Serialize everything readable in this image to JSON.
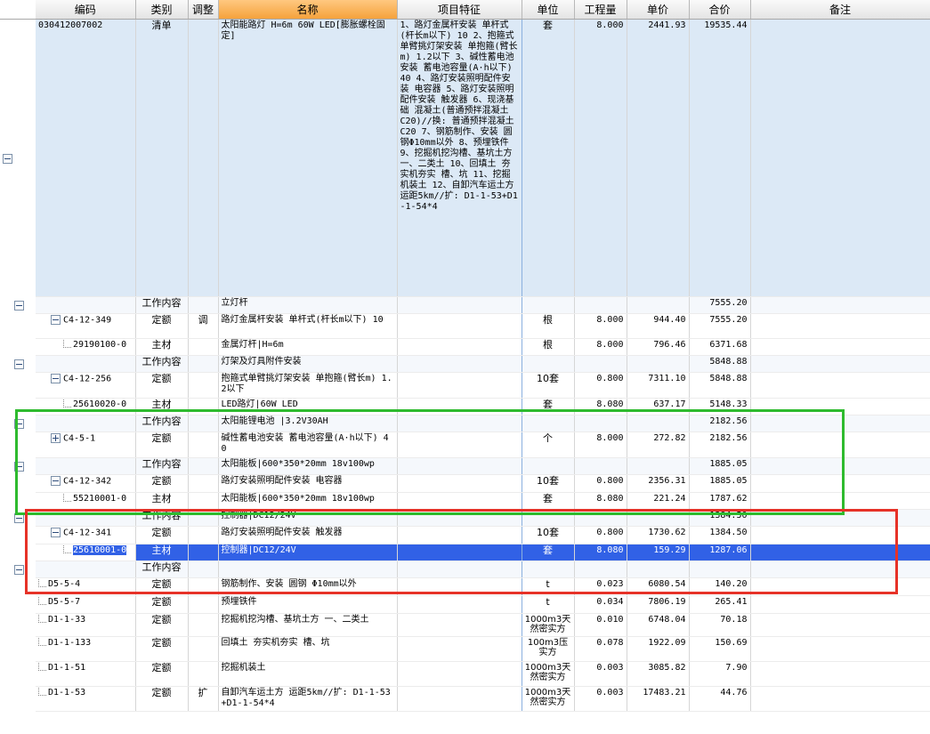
{
  "columns": {
    "code": "编码",
    "type": "类别",
    "adjust": "调整",
    "name": "名称",
    "spec": "项目特征",
    "unit": "单位",
    "qty": "工程量",
    "price": "单价",
    "total": "合价",
    "note": "备注"
  },
  "qingdan": {
    "code": "030412007002",
    "type": "清单",
    "name": "太阳能路灯 H=6m 60W LED[膨胀螺栓固定]",
    "spec": "1、路灯金属杆安装 单杆式(杆长m以下) 10 2、抱箍式单臂挑灯架安装 单抱箍(臂长m) 1.2以下 3、碱性蓄电池安装 蓄电池容量(A·h以下) 40 4、路灯安装照明配件安装 电容器 5、路灯安装照明配件安装 触发器 6、现浇基础 混凝土(普通预拌混凝土 C20)//换: 普通预拌混凝土 C20 7、钢筋制作、安装 圆钢Φ10mm以外 8、预埋铁件 9、挖掘机挖沟槽、基坑土方 一、二类土 10、回填土 夯实机夯实 槽、坑 11、挖掘机装土 12、自卸汽车运土方 运距5km//扩: D1-1-53+D1-1-54*4",
    "unit": "套",
    "qty": "8.000",
    "price": "2441.93",
    "total": "19535.44"
  },
  "rows": [
    {
      "kind": "wc",
      "level": 0,
      "btn": "minus",
      "code": "",
      "type": "工作内容",
      "adjust": "",
      "name": "立灯杆",
      "unit": "",
      "qty": "",
      "price": "",
      "total": "7555.20"
    },
    {
      "kind": "de",
      "level": 1,
      "btn": "minus",
      "code": "C4-12-349",
      "type": "定额",
      "adjust": "调",
      "name": "路灯金属杆安装 单杆式(杆长m以下) 10",
      "unit": "根",
      "qty": "8.000",
      "price": "944.40",
      "total": "7555.20"
    },
    {
      "kind": "zc",
      "level": 2,
      "btn": "line",
      "code": "29190100-0",
      "type": "主材",
      "adjust": "",
      "name": "金属灯杆|H=6m",
      "unit": "根",
      "qty": "8.000",
      "price": "796.46",
      "total": "6371.68"
    },
    {
      "kind": "wc",
      "level": 0,
      "btn": "minus",
      "code": "",
      "type": "工作内容",
      "adjust": "",
      "name": "灯架及灯具附件安装",
      "unit": "",
      "qty": "",
      "price": "",
      "total": "5848.88"
    },
    {
      "kind": "de",
      "level": 1,
      "btn": "minus",
      "code": "C4-12-256",
      "type": "定额",
      "adjust": "",
      "name": "抱箍式单臂挑灯架安装 单抱箍(臂长m) 1.2以下",
      "unit": "10套",
      "qty": "0.800",
      "price": "7311.10",
      "total": "5848.88"
    },
    {
      "kind": "zc",
      "level": 2,
      "btn": "line",
      "code": "25610020-0",
      "type": "主材",
      "adjust": "",
      "name": "LED路灯|60W LED",
      "unit": "套",
      "qty": "8.080",
      "price": "637.17",
      "total": "5148.33"
    },
    {
      "kind": "wc",
      "level": 0,
      "btn": "minus",
      "code": "",
      "type": "工作内容",
      "adjust": "",
      "name": "太阳能锂电池 |3.2V30AH",
      "unit": "",
      "qty": "",
      "price": "",
      "total": "2182.56"
    },
    {
      "kind": "de",
      "level": 1,
      "btn": "plus",
      "code": "C4-5-1",
      "type": "定额",
      "adjust": "",
      "name": "碱性蓄电池安装 蓄电池容量(A·h以下) 40",
      "unit": "个",
      "qty": "8.000",
      "price": "272.82",
      "total": "2182.56"
    },
    {
      "kind": "wc",
      "level": 0,
      "btn": "minus",
      "code": "",
      "type": "工作内容",
      "adjust": "",
      "name": "太阳能板|600*350*20mm 18v100wp",
      "unit": "",
      "qty": "",
      "price": "",
      "total": "1885.05"
    },
    {
      "kind": "de",
      "level": 1,
      "btn": "minus",
      "code": "C4-12-342",
      "type": "定额",
      "adjust": "",
      "name": "路灯安装照明配件安装 电容器",
      "unit": "10套",
      "qty": "0.800",
      "price": "2356.31",
      "total": "1885.05"
    },
    {
      "kind": "zc",
      "level": 2,
      "btn": "line",
      "code": "55210001-0",
      "type": "主材",
      "adjust": "",
      "name": "太阳能板|600*350*20mm 18v100wp",
      "unit": "套",
      "qty": "8.080",
      "price": "221.24",
      "total": "1787.62"
    },
    {
      "kind": "wc",
      "level": 0,
      "btn": "minus",
      "code": "",
      "type": "工作内容",
      "adjust": "",
      "name": "控制器|DC12/24V",
      "unit": "",
      "qty": "",
      "price": "",
      "total": "1384.50"
    },
    {
      "kind": "de",
      "level": 1,
      "btn": "minus",
      "code": "C4-12-341",
      "type": "定额",
      "adjust": "",
      "name": "路灯安装照明配件安装 触发器",
      "unit": "10套",
      "qty": "0.800",
      "price": "1730.62",
      "total": "1384.50"
    },
    {
      "kind": "sel",
      "level": 2,
      "btn": "line",
      "code": "25610001-0",
      "type": "主材",
      "adjust": "",
      "name": "控制器|DC12/24V",
      "unit": "套",
      "qty": "8.080",
      "price": "159.29",
      "total": "1287.06"
    },
    {
      "kind": "wc",
      "level": 0,
      "btn": "minus",
      "code": "",
      "type": "工作内容",
      "adjust": "",
      "name": "",
      "unit": "",
      "qty": "",
      "price": "",
      "total": ""
    },
    {
      "kind": "de",
      "level": 0,
      "btn": "line",
      "code": "D5-5-4",
      "type": "定额",
      "adjust": "",
      "name": "钢筋制作、安装 圆钢 Φ10mm以外",
      "unit": "t",
      "qty": "0.023",
      "price": "6080.54",
      "total": "140.20"
    },
    {
      "kind": "de",
      "level": 0,
      "btn": "line",
      "code": "D5-5-7",
      "type": "定额",
      "adjust": "",
      "name": "预埋铁件",
      "unit": "t",
      "qty": "0.034",
      "price": "7806.19",
      "total": "265.41"
    },
    {
      "kind": "de",
      "level": 0,
      "btn": "line",
      "code": "D1-1-33",
      "type": "定额",
      "adjust": "",
      "name": "挖掘机挖沟槽、基坑土方 一、二类土",
      "unit": "1000m3天然密实方",
      "qty": "0.010",
      "price": "6748.04",
      "total": "70.18"
    },
    {
      "kind": "de",
      "level": 0,
      "btn": "line",
      "code": "D1-1-133",
      "type": "定额",
      "adjust": "",
      "name": "回填土 夯实机夯实 槽、坑",
      "unit": "100m3压实方",
      "qty": "0.078",
      "price": "1922.09",
      "total": "150.69"
    },
    {
      "kind": "de",
      "level": 0,
      "btn": "line",
      "code": "D1-1-51",
      "type": "定额",
      "adjust": "",
      "name": "挖掘机装土",
      "unit": "1000m3天然密实方",
      "qty": "0.003",
      "price": "3085.82",
      "total": "7.90"
    },
    {
      "kind": "de",
      "level": 0,
      "btn": "line",
      "code": "D1-1-53",
      "type": "定额",
      "adjust": "扩",
      "name": "自卸汽车运土方 运距5km//扩: D1-1-53+D1-1-54*4",
      "unit": "1000m3天然密实方",
      "qty": "0.003",
      "price": "17483.21",
      "total": "44.76"
    }
  ],
  "colors": {
    "header_highlight": "#f5a23c",
    "qingdan_bg": "#dce9f6",
    "selected_row": "#3161e6",
    "green_box": "#2ebb2e",
    "red_box": "#e63228"
  }
}
